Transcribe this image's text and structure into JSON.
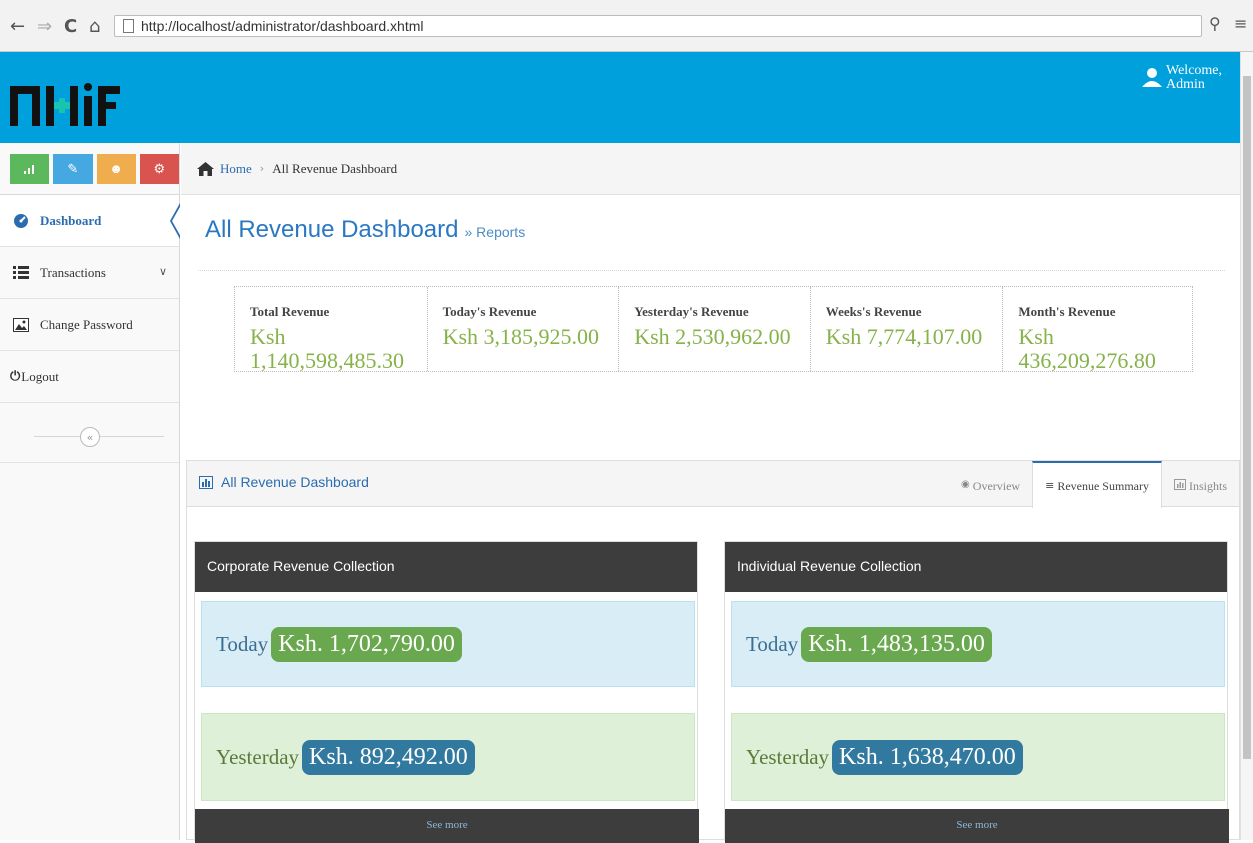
{
  "browser": {
    "url": "http://localhost/administrator/dashboard.xhtml",
    "back_icon": "arrow-left-icon",
    "forward_icon": "arrow-right-icon",
    "reload_icon": "reload-icon",
    "home_icon": "home-icon"
  },
  "header": {
    "logo_alt": "NHIF",
    "welcome_line1": "Welcome,",
    "welcome_line2": "Admin",
    "bg_color": "#00a0dc"
  },
  "sidebar": {
    "shortcut_colors": [
      "#5cb85c",
      "#45a8e0",
      "#f0ad4e",
      "#d9534f"
    ],
    "items": [
      {
        "label": "Dashboard",
        "icon": "dashboard-icon",
        "active": true
      },
      {
        "label": "Transactions",
        "icon": "list-icon"
      },
      {
        "label": "Change Password",
        "icon": "picture-icon"
      },
      {
        "label": "Logout",
        "icon": "power-icon"
      }
    ]
  },
  "breadcrumb": {
    "home": "Home",
    "current": "All Revenue Dashboard"
  },
  "page": {
    "title": "All Revenue Dashboard",
    "subtitle": "» Reports"
  },
  "stats": [
    {
      "label": "Total Revenue",
      "value": "Ksh 1,140,598,485.30"
    },
    {
      "label": "Today's Revenue",
      "value": "Ksh 3,185,925.00"
    },
    {
      "label": "Yesterday's Revenue",
      "value": "Ksh 2,530,962.00"
    },
    {
      "label": "Weeks's Revenue",
      "value": "Ksh 7,774,107.00"
    },
    {
      "label": "Month's Revenue",
      "value": "Ksh 436,209,276.80"
    }
  ],
  "widget": {
    "title": "All Revenue Dashboard",
    "tabs": [
      {
        "label": "Overview",
        "icon": "eye-icon"
      },
      {
        "label": "Revenue Summary",
        "icon": "bars-icon",
        "active": true
      },
      {
        "label": "Insights",
        "icon": "chart-icon"
      }
    ]
  },
  "panels": [
    {
      "title": "Corporate Revenue Collection",
      "today_label": "Today",
      "today_value": "Ksh. 1,702,790.00",
      "yesterday_label": "Yesterday",
      "yesterday_value": "Ksh. 892,492.00",
      "see_more": "See more"
    },
    {
      "title": "Individual Revenue Collection",
      "today_label": "Today",
      "today_value": "Ksh. 1,483,135.00",
      "yesterday_label": "Yesterday",
      "yesterday_value": "Ksh. 1,638,470.00",
      "see_more": "See more"
    }
  ]
}
